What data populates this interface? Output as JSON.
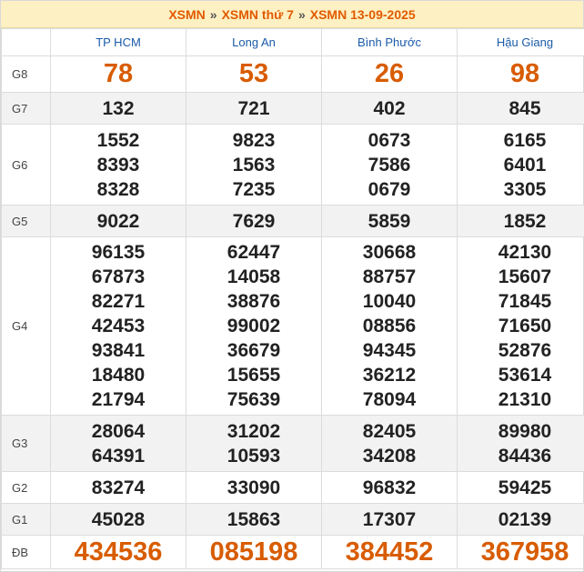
{
  "breadcrumb": {
    "part1": "XSMN",
    "separator": "»",
    "part2": "XSMN thứ 7",
    "part3": "XSMN 13-09-2025"
  },
  "provinces": [
    "TP HCM",
    "Long An",
    "Bình Phước",
    "Hậu Giang"
  ],
  "prizes": [
    {
      "label": "G8",
      "values": [
        [
          "78"
        ],
        [
          "53"
        ],
        [
          "26"
        ],
        [
          "98"
        ]
      ]
    },
    {
      "label": "G7",
      "values": [
        [
          "132"
        ],
        [
          "721"
        ],
        [
          "402"
        ],
        [
          "845"
        ]
      ]
    },
    {
      "label": "G6",
      "values": [
        [
          "1552",
          "8393",
          "8328"
        ],
        [
          "9823",
          "1563",
          "7235"
        ],
        [
          "0673",
          "7586",
          "0679"
        ],
        [
          "6165",
          "6401",
          "3305"
        ]
      ]
    },
    {
      "label": "G5",
      "values": [
        [
          "9022"
        ],
        [
          "7629"
        ],
        [
          "5859"
        ],
        [
          "1852"
        ]
      ]
    },
    {
      "label": "G4",
      "values": [
        [
          "96135",
          "67873",
          "82271",
          "42453",
          "93841",
          "18480",
          "21794"
        ],
        [
          "62447",
          "14058",
          "38876",
          "99002",
          "36679",
          "15655",
          "75639"
        ],
        [
          "30668",
          "88757",
          "10040",
          "08856",
          "94345",
          "36212",
          "78094"
        ],
        [
          "42130",
          "15607",
          "71845",
          "71650",
          "52876",
          "53614",
          "21310"
        ]
      ]
    },
    {
      "label": "G3",
      "values": [
        [
          "28064",
          "64391"
        ],
        [
          "31202",
          "10593"
        ],
        [
          "82405",
          "34208"
        ],
        [
          "89980",
          "84436"
        ]
      ]
    },
    {
      "label": "G2",
      "values": [
        [
          "83274"
        ],
        [
          "33090"
        ],
        [
          "96832"
        ],
        [
          "59425"
        ]
      ]
    },
    {
      "label": "G1",
      "values": [
        [
          "45028"
        ],
        [
          "15863"
        ],
        [
          "17307"
        ],
        [
          "02139"
        ]
      ]
    },
    {
      "label": "ĐB",
      "values": [
        [
          "434536"
        ],
        [
          "085198"
        ],
        [
          "384452"
        ],
        [
          "367958"
        ]
      ]
    }
  ]
}
